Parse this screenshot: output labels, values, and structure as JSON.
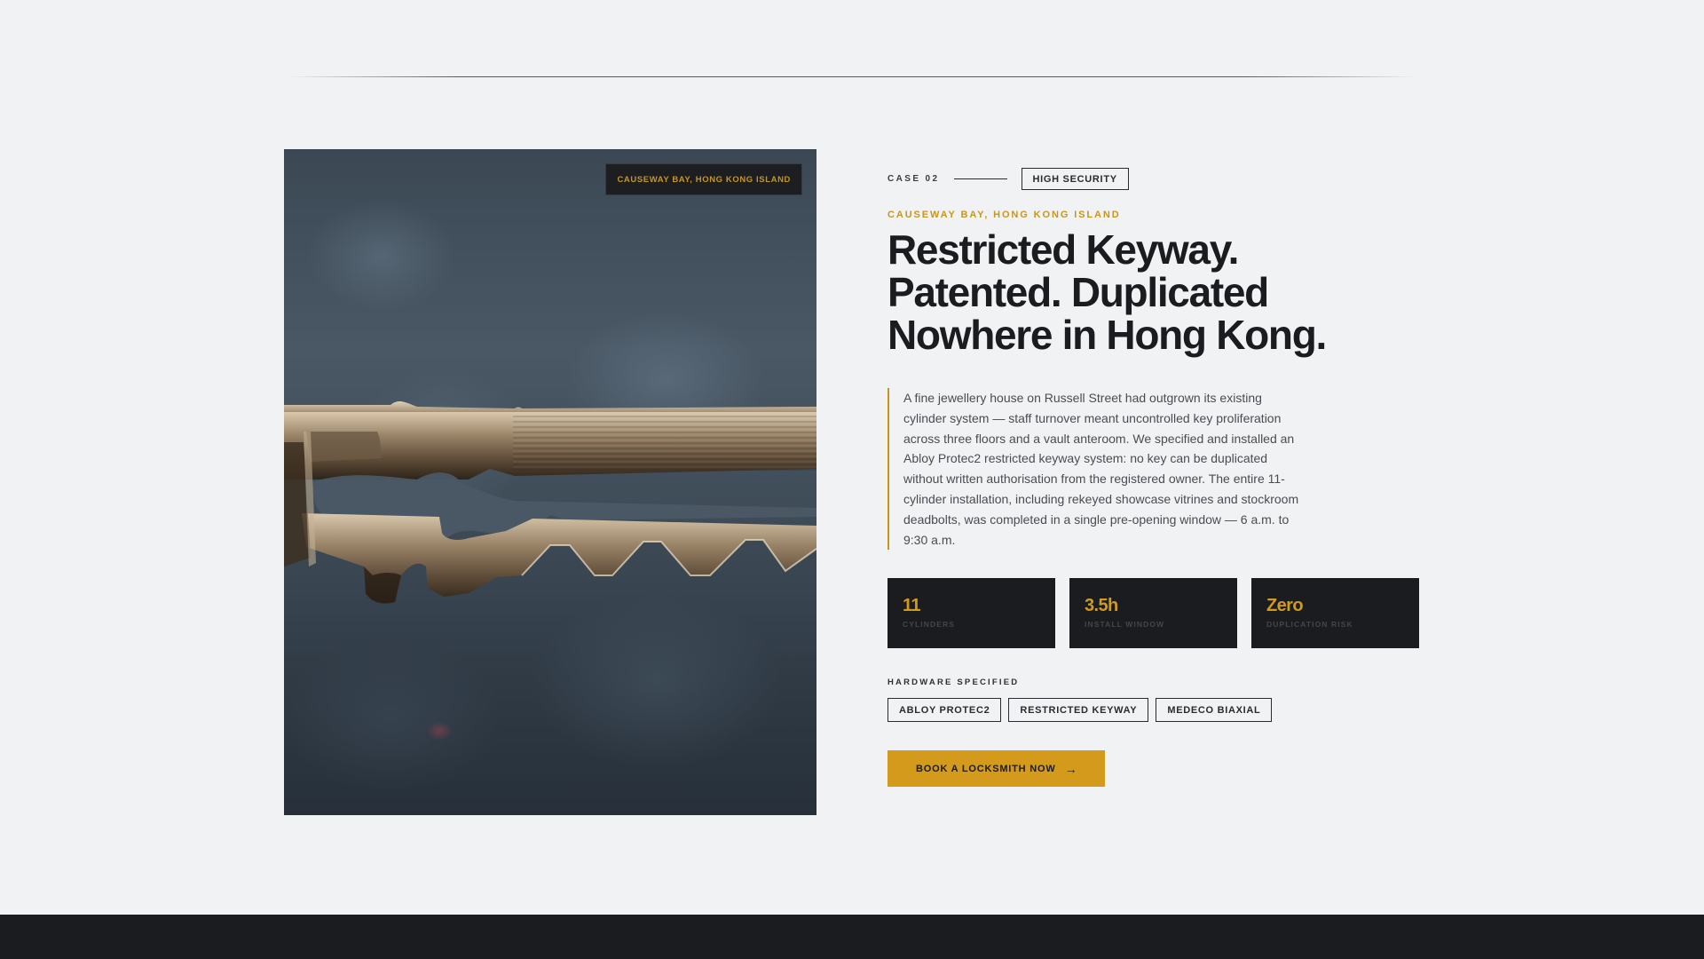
{
  "photo": {
    "tag": "CAUSEWAY BAY, HONG KONG ISLAND",
    "subject_icon": "key-closeup-image"
  },
  "case": {
    "label": "CASE 02",
    "badge": "HIGH SECURITY",
    "location": "CAUSEWAY BAY, HONG KONG ISLAND",
    "headline_lines": [
      "Restricted Keyway.",
      "Patented. Duplicated",
      "Nowhere in Hong Kong."
    ],
    "body": "A fine jewellery house on Russell Street had outgrown its existing cylinder system — staff turnover meant uncontrolled key proliferation across three floors and a vault anteroom. We specified and installed an Abloy Protec2 restricted keyway system: no key can be duplicated without written authorisation from the registered owner. The entire 11-cylinder installation, including rekeyed showcase vitrines and stockroom deadbolts, was completed in a single pre-opening window — 6 a.m. to 9:30 a.m."
  },
  "stats": [
    {
      "value": "11",
      "label": "CYLINDERS"
    },
    {
      "value": "3.5h",
      "label": "INSTALL WINDOW"
    },
    {
      "value": "Zero",
      "label": "DUPLICATION RISK"
    }
  ],
  "hardware": {
    "title": "HARDWARE SPECIFIED",
    "items": [
      "ABLOY PROTEC2",
      "RESTRICTED KEYWAY",
      "MEDECO BIAXIAL"
    ]
  },
  "cta": {
    "label": "BOOK A LOCKSMITH NOW",
    "icon": "arrow-right-icon"
  },
  "colors": {
    "accent": "#d39a1b",
    "dark": "#1b1c20",
    "background": "#f1f2f4"
  }
}
